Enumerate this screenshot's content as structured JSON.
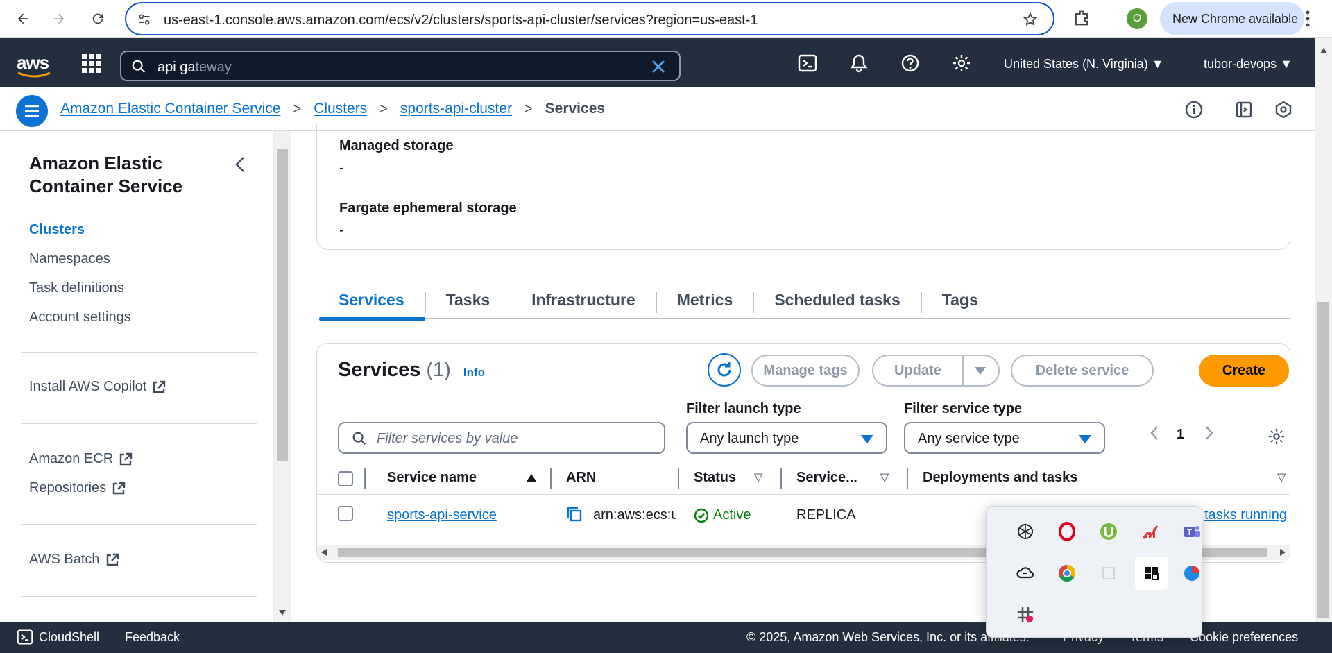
{
  "browser": {
    "url": "us-east-1.console.aws.amazon.com/ecs/v2/clusters/sports-api-cluster/services?region=us-east-1",
    "profile_initial": "O",
    "update_label": "New Chrome available"
  },
  "topnav": {
    "logo": "aws",
    "search_typed": "api ga",
    "search_suggestion": "teway",
    "region": "United States (N. Virginia)",
    "account": "tubor-devops"
  },
  "breadcrumb": {
    "items": [
      "Amazon Elastic Container Service",
      "Clusters",
      "sports-api-cluster"
    ],
    "current": "Services"
  },
  "sidebar": {
    "title": "Amazon Elastic Container Service",
    "items": [
      "Clusters",
      "Namespaces",
      "Task definitions",
      "Account settings"
    ],
    "copilot": "Install AWS Copilot",
    "ecr": "Amazon ECR",
    "repositories": "Repositories",
    "batch": "AWS Batch"
  },
  "details": {
    "managed_storage_label": "Managed storage",
    "managed_storage_value": "-",
    "fargate_label": "Fargate ephemeral storage",
    "fargate_value": "-"
  },
  "tabs": [
    "Services",
    "Tasks",
    "Infrastructure",
    "Metrics",
    "Scheduled tasks",
    "Tags"
  ],
  "services": {
    "title": "Services",
    "count": "(1)",
    "info": "Info",
    "manage_tags": "Manage tags",
    "update": "Update",
    "delete": "Delete service",
    "create": "Create",
    "filter_launch_label": "Filter launch type",
    "filter_service_label": "Filter service type",
    "search_placeholder": "Filter services by value",
    "launch_value": "Any launch type",
    "service_value": "Any service type",
    "page": "1",
    "columns": [
      "Service name",
      "ARN",
      "Status",
      "Service...",
      "Deployments and tasks"
    ],
    "rows": [
      {
        "name": "sports-api-service",
        "arn": "arn:aws:ecs:us-e",
        "status": "Active",
        "service_type": "REPLICA",
        "deployments": "tasks running"
      }
    ]
  },
  "footer": {
    "cloudshell": "CloudShell",
    "feedback": "Feedback",
    "copyright": "© 2025, Amazon Web Services, Inc. or its affiliates.",
    "privacy": "Privacy",
    "terms": "Terms",
    "cookies": "Cookie preferences"
  },
  "colors": {
    "aws_nav": "#232f3e",
    "link_blue": "#0972d3",
    "create_orange": "#ff9900",
    "active_green": "#037f0c"
  }
}
